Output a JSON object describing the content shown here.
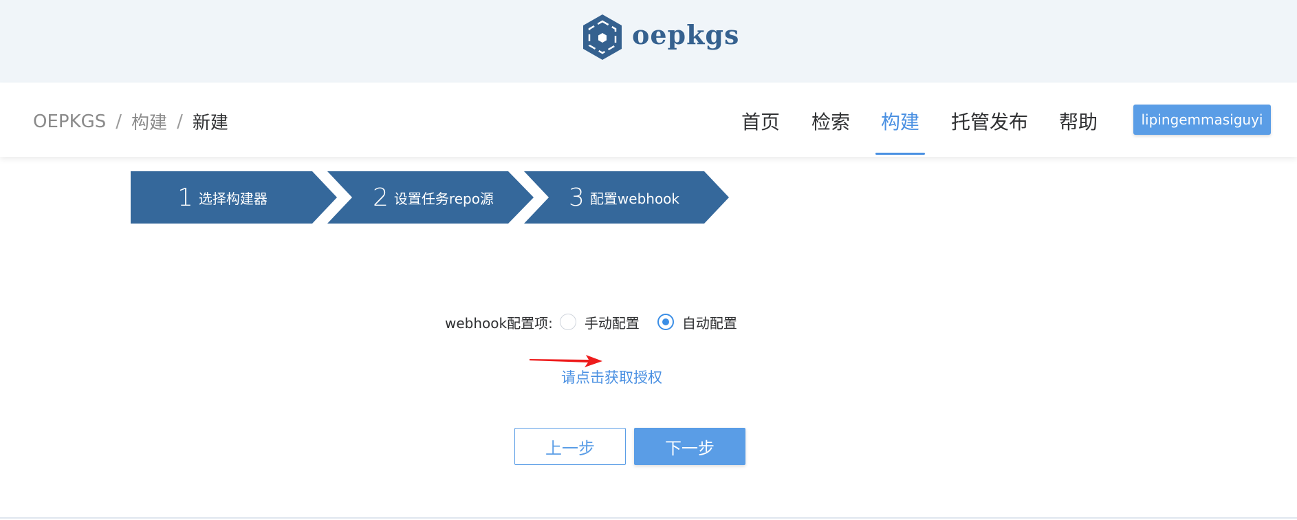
{
  "brand": {
    "name": "oepkgs",
    "color": "#35618f",
    "logo_icon": "hexagon-logo-icon"
  },
  "breadcrumb": {
    "root": "OEPKGS",
    "sep1": "/",
    "section": "构建",
    "sep2": "/",
    "current": "新建"
  },
  "nav": {
    "items": [
      {
        "label": "首页"
      },
      {
        "label": "检索"
      },
      {
        "label": "构建",
        "active": true
      },
      {
        "label": "托管发布"
      },
      {
        "label": "帮助"
      }
    ],
    "user": "lipingemmasiguyi",
    "accent": "#4a90e2"
  },
  "steps": [
    {
      "num": "1",
      "label": "选择构建器"
    },
    {
      "num": "2",
      "label": "设置任务repo源"
    },
    {
      "num": "3",
      "label": "配置webhook"
    }
  ],
  "steps_color": "#35689b",
  "form": {
    "label": "webhook配置项:",
    "options": [
      {
        "label": "手动配置",
        "checked": false
      },
      {
        "label": "自动配置",
        "checked": true
      }
    ]
  },
  "auth_link": "请点击获取授权",
  "buttons": {
    "prev": "上一步",
    "next": "下一步"
  }
}
